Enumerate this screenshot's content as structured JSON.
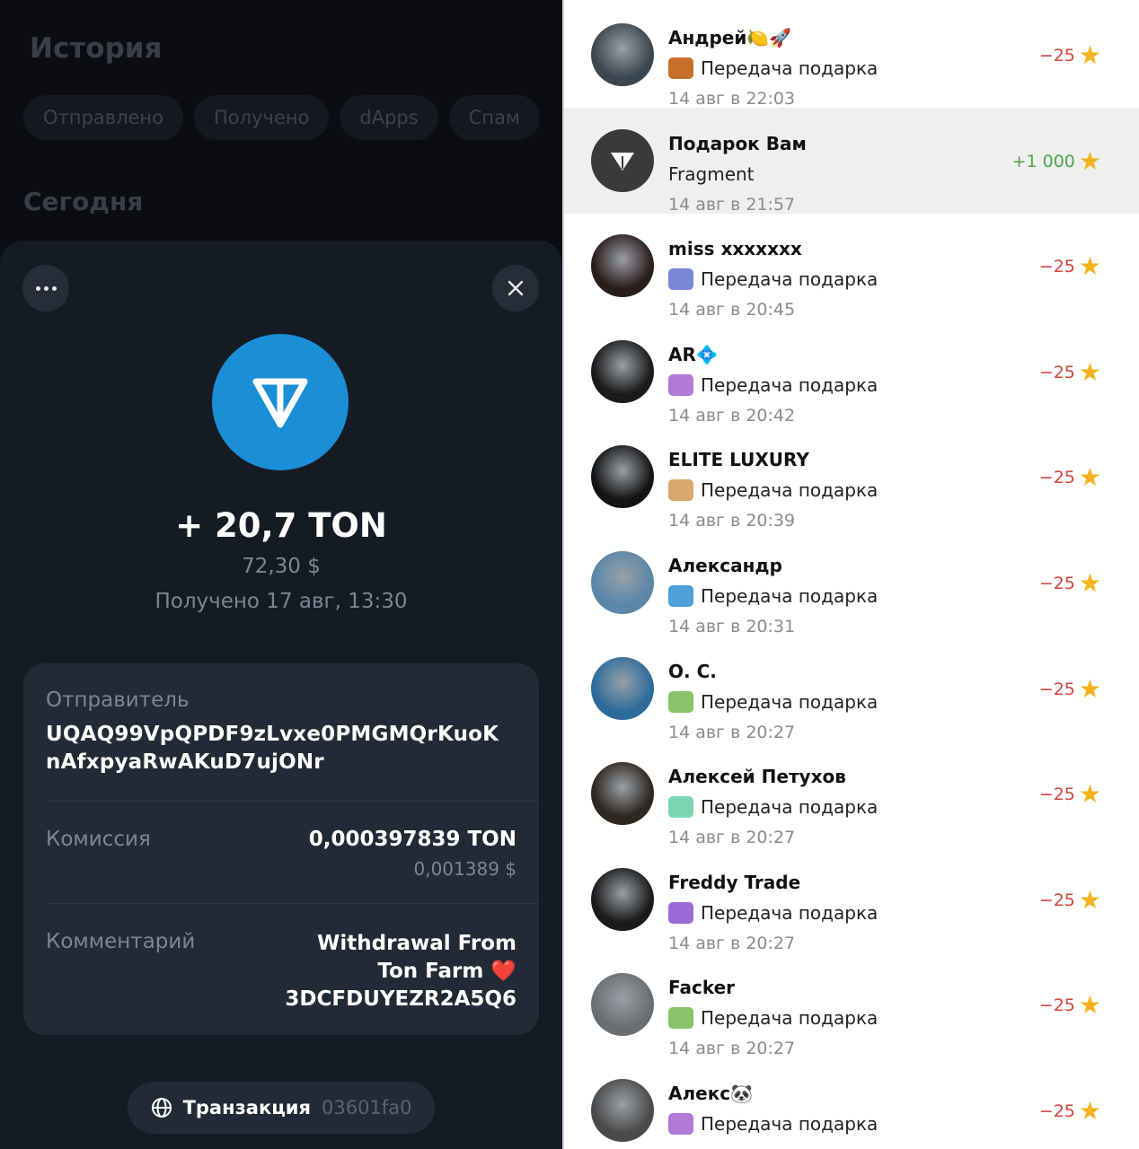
{
  "wallet": {
    "title": "История",
    "filters": [
      "Отправлено",
      "Получено",
      "dApps",
      "Спам"
    ],
    "section_today": "Сегодня",
    "detail": {
      "amount": "+ 20,7 TON",
      "usd": "72,30 $",
      "received": "Получено 17 авг, 13:30",
      "sender_label": "Отправитель",
      "sender_line1": "UQAQ99VpQPDF9zLvxe0PMGMQrKuoK",
      "sender_line2": "nAfxpyaRwAKuD7ujONr",
      "fee_label": "Комиссия",
      "fee_value": "0,000397839 TON",
      "fee_usd": "0,001389 $",
      "comment_label": "Комментарий",
      "comment_line1": "Withdrawal From",
      "comment_line2": "Ton Farm ❤️",
      "comment_line3": "3DCFDUYEZR2A5Q6",
      "tx_label": "Транзакция",
      "tx_hash": "03601fa0"
    },
    "colors": {
      "accent": "#1a8ed6",
      "background": "#0b0d12",
      "sheet": "#151b25",
      "card": "#222a37"
    }
  },
  "transactions": [
    {
      "name": "Андрей🍋🚀",
      "desc": "Передача подарка",
      "time": "14 авг в 22:03",
      "amount": "−25",
      "avatar_color": "#3a4650",
      "gift_color": "#c96f2c"
    },
    {
      "name": "Подарок Вам",
      "desc": "Fragment",
      "time": "14 авг в 21:57",
      "amount": "+1 000",
      "avatar_color": "#3a3a3a",
      "gift_color": ""
    },
    {
      "name": "miss xxxxxxx",
      "desc": "Передача подарка",
      "time": "14 авг в 20:45",
      "amount": "−25",
      "avatar_color": "#2a1c1c",
      "gift_color": "#7c86d6"
    },
    {
      "name": "AR💠",
      "desc": "Передача подарка",
      "time": "14 авг в 20:42",
      "amount": "−25",
      "avatar_color": "#1a1a1a",
      "gift_color": "#b07ad6"
    },
    {
      "name": "ELITE LUXURY",
      "desc": "Передача подарка",
      "time": "14 авг в 20:39",
      "amount": "−25",
      "avatar_color": "#141414",
      "gift_color": "#d9a870"
    },
    {
      "name": "Александр",
      "desc": "Передача подарка",
      "time": "14 авг в 20:31",
      "amount": "−25",
      "avatar_color": "#5a86a8",
      "gift_color": "#4fa0d8"
    },
    {
      "name": "О. С.",
      "desc": "Передача подарка",
      "time": "14 авг в 20:27",
      "amount": "−25",
      "avatar_color": "#2c6c9c",
      "gift_color": "#89c46a"
    },
    {
      "name": "Алексей Петухов",
      "desc": "Передача подарка",
      "time": "14 авг в 20:27",
      "amount": "−25",
      "avatar_color": "#2e2620",
      "gift_color": "#7bd6b4"
    },
    {
      "name": "Freddy Trade",
      "desc": "Передача подарка",
      "time": "14 авг в 20:27",
      "amount": "−25",
      "avatar_color": "#1a1a1a",
      "gift_color": "#9a6ad6"
    },
    {
      "name": "Facker",
      "desc": "Передача подарка",
      "time": "14 авг в 20:27",
      "amount": "−25",
      "avatar_color": "#6a6e72",
      "gift_color": "#89c46a"
    },
    {
      "name": "Алекс🐼",
      "desc": "Передача подарка",
      "time": "",
      "amount": "−25",
      "avatar_color": "#4a4a4a",
      "gift_color": "#b07ad6"
    }
  ]
}
